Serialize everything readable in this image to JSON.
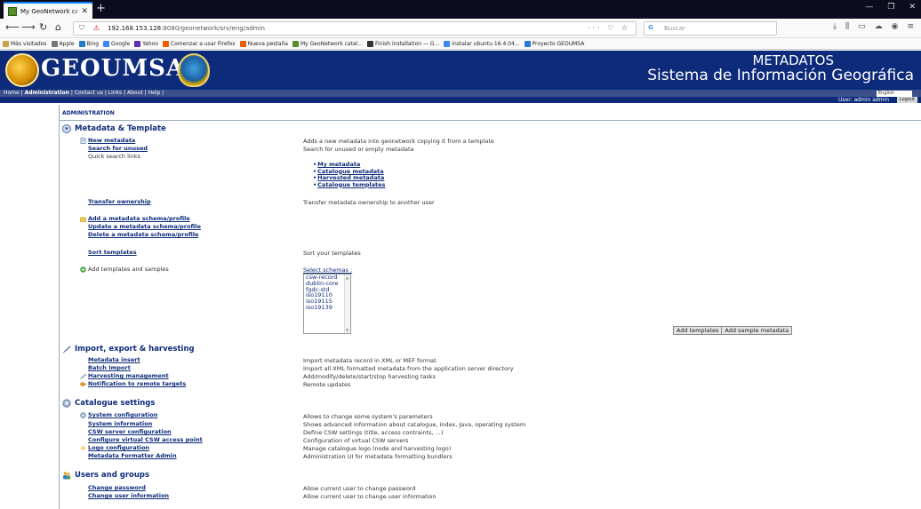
{
  "browser": {
    "tab_title": "My GeoNetwork catalogue",
    "url_prefix": "192.168.153.128",
    "url_rest": ":8080/geonetwork/srv/eng/admin",
    "url_actions": "··· ♡ ☆",
    "search_placeholder": "Buscar",
    "bookmarks": [
      {
        "label": "Más visitados",
        "color": "#caa24a"
      },
      {
        "label": "Apple",
        "color": "#777777"
      },
      {
        "label": "Bing",
        "color": "#1f7cc7"
      },
      {
        "label": "Google",
        "color": "#4285f4"
      },
      {
        "label": "Yahoo",
        "color": "#5f2eb5"
      },
      {
        "label": "Comenzar a usar Firefox",
        "color": "#e66000"
      },
      {
        "label": "Nueva pestaña",
        "color": "#e66000"
      },
      {
        "label": "My GeoNetwork catal...",
        "color": "#5a8c2c"
      },
      {
        "label": "Finish installation — G...",
        "color": "#333333"
      },
      {
        "label": "instalar ubuntu 16.4.04...",
        "color": "#4285f4"
      },
      {
        "label": "Proyecto GEOUMSA",
        "color": "#2b7bd6"
      }
    ]
  },
  "banner": {
    "logo_text": "GEOUMSA",
    "title_line1": "METADATOS",
    "title_line2": "Sistema de Información Geográfica"
  },
  "topnav": {
    "home": "Home",
    "administration": "Administration",
    "rest": "| Contact us | Links | About | Help |",
    "language": "English",
    "user": "User: admin admin",
    "logout": "Logout"
  },
  "page": {
    "heading": "ADMINISTRATION",
    "sections": {
      "metadata": "Metadata & Template",
      "import": "Import, export & harvesting",
      "catalogue": "Catalogue settings",
      "users": "Users and groups"
    },
    "metadata_items": {
      "new_metadata": "New metadata",
      "new_metadata_desc": "Adds a new metadata into geonetwork copying it from a template",
      "search_unused": "Search for unused",
      "search_unused_desc": "Search for unused or empty metadata",
      "quick_search": "Quick search links",
      "quick_links": [
        "My metadata",
        "Catalogue metadata",
        "Harvested metadata",
        "Catalogue templates"
      ],
      "transfer": "Transfer ownership",
      "transfer_desc": "Transfer metadata ownership to another user",
      "add_schema": "Add a metadata schema/profile",
      "update_schema": "Update a metadata schema/profile",
      "delete_schema": "Delete a metadata schema/profile",
      "sort_templates": "Sort templates",
      "sort_templates_desc": "Sort your templates",
      "add_templates": "Add templates and samples",
      "select_schemas": "Select schemas :",
      "schemas": [
        "csw-record",
        "dublin-core",
        "fgdc-std",
        "iso19110",
        "iso19115",
        "iso19139"
      ],
      "btn_add_templates": "Add templates",
      "btn_add_sample": "Add sample metadata"
    },
    "import_items": {
      "metadata_insert": "Metadata insert",
      "metadata_insert_desc": "Import metadata record in XML or MEF format",
      "batch_import": "Batch Import",
      "batch_import_desc": "Import all XML formatted metadata from the application server directory",
      "harvesting": "Harvesting management",
      "harvesting_desc": "Add/modify/delete/start/stop harvesting tasks",
      "notification": "Notification to remote targets",
      "notification_desc": "Remote updates"
    },
    "catalogue_items": {
      "system_config": "System configuration",
      "system_config_desc": "Allows to change some system's parameters",
      "system_info": "System information",
      "system_info_desc": "Shows advanced information about catalogue, index, Java, operating system",
      "csw_config": "CSW server configuration",
      "csw_config_desc": "Define CSW settings (title, access contraints, ...)",
      "virtual_csw": "Configure virtual CSW access point",
      "virtual_csw_desc": "Configuration of virtual CSW servers",
      "logo_config": "Logo configuration",
      "logo_config_desc": "Manage catalogue logo (node and harvesting logo)",
      "formatter": "Metadata Formatter Admin",
      "formatter_desc": "Administration UI for metadata formatting bundlers"
    },
    "users_items": {
      "change_password": "Change password",
      "change_password_desc": "Allow current user to change password",
      "change_info": "Change user information",
      "change_info_desc": "Allow current user to change user information"
    }
  }
}
